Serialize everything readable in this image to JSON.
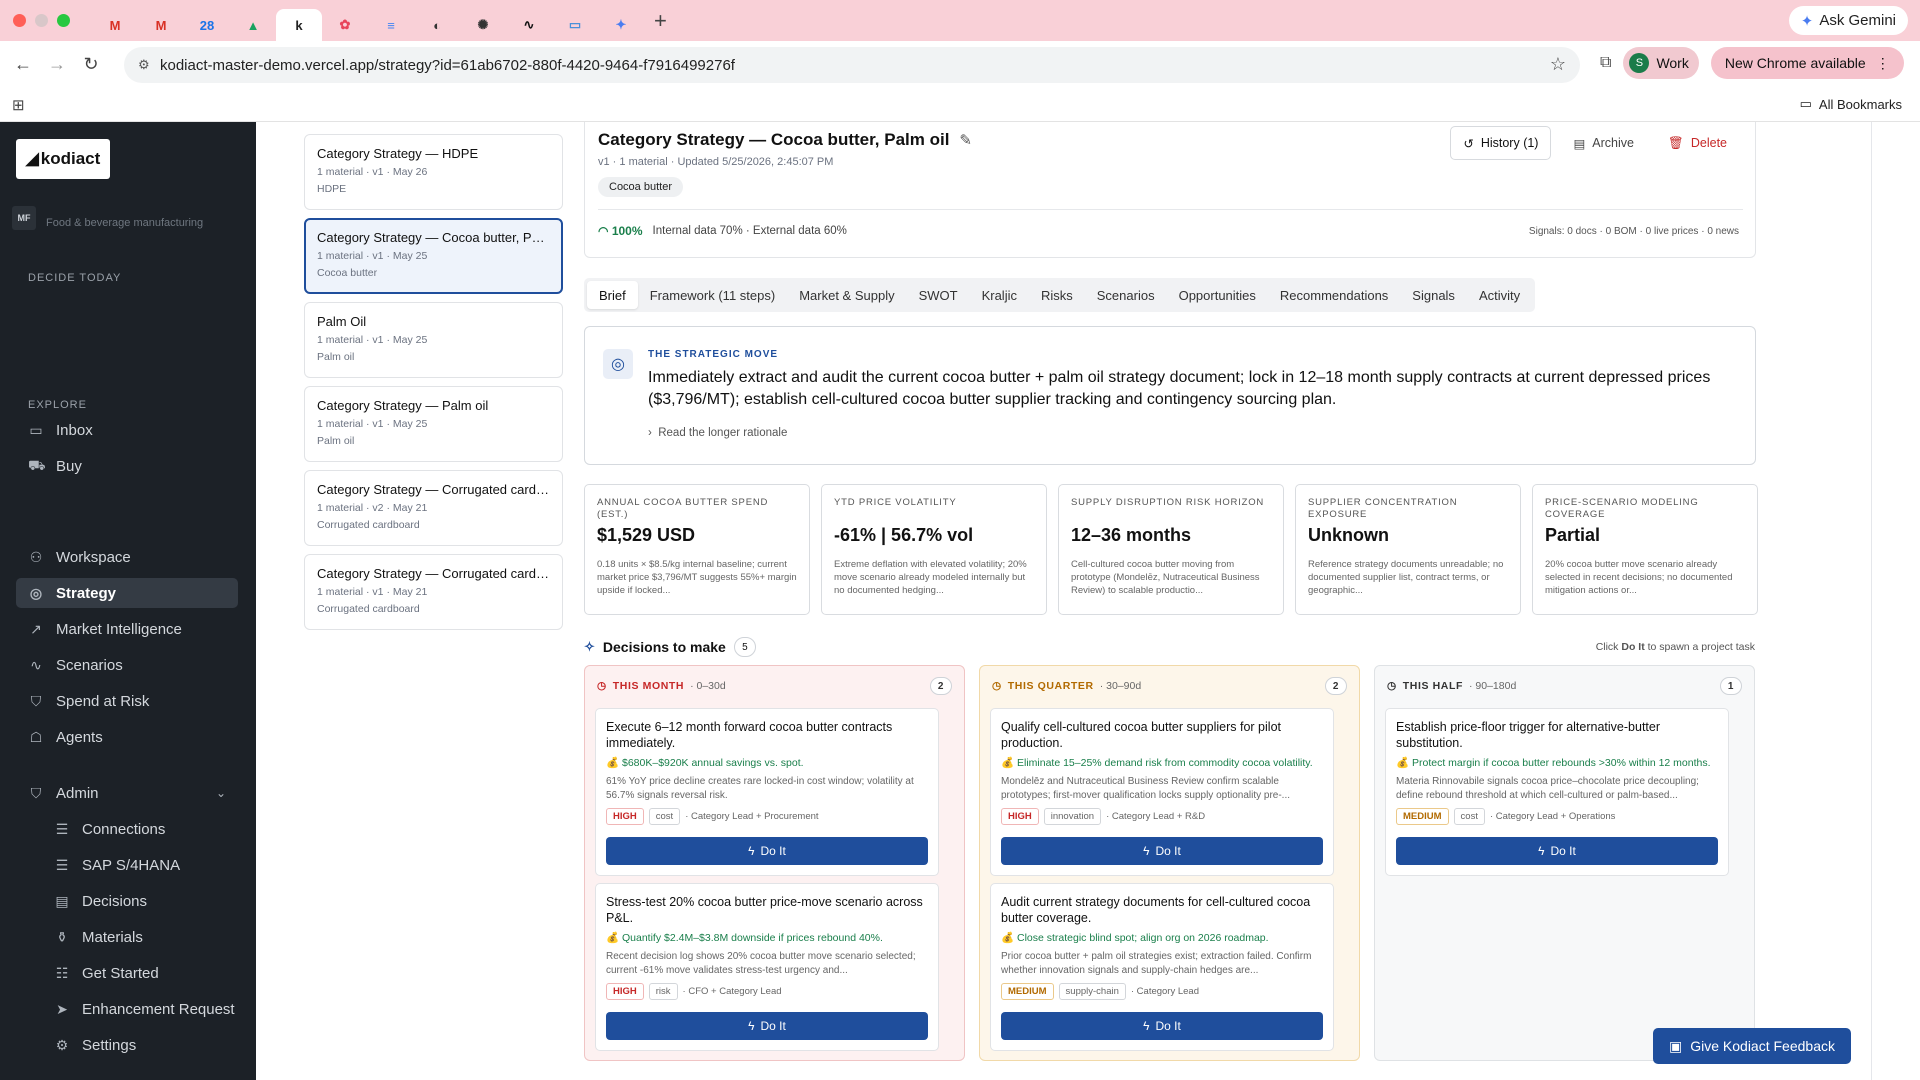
{
  "browser": {
    "tabs": [
      {
        "icon": "gmail-icon",
        "glyph": "M",
        "color": "#d93025"
      },
      {
        "icon": "gmail-icon",
        "glyph": "M",
        "color": "#d93025"
      },
      {
        "icon": "calendar-icon",
        "glyph": "28",
        "color": "#1a73e8"
      },
      {
        "icon": "drive-icon",
        "glyph": "▲",
        "color": "#1aa260"
      },
      {
        "icon": "kodiact-tab-icon",
        "glyph": "k",
        "color": "#222"
      },
      {
        "icon": "flower-icon",
        "glyph": "✿",
        "color": "#e8455a"
      },
      {
        "icon": "docs-icon",
        "glyph": "≡",
        "color": "#4285f4"
      },
      {
        "icon": "globe-icon",
        "glyph": "◐",
        "color": "#333"
      },
      {
        "icon": "openai-icon",
        "glyph": "✺",
        "color": "#333"
      },
      {
        "icon": "activity-icon",
        "glyph": "∿",
        "color": "#111"
      },
      {
        "icon": "window-icon",
        "glyph": "▭",
        "color": "#4a90d9"
      },
      {
        "icon": "gemini-tab-icon",
        "glyph": "✦",
        "color": "#4a7cf0"
      }
    ],
    "ask_gemini": "Ask Gemini",
    "url": "kodiact-master-demo.vercel.app/strategy?id=61ab6702-880f-4420-9464-f7916499276f",
    "profile_initial": "S",
    "profile_label": "Work",
    "update_label": "New Chrome available",
    "bookmarks_label": "All Bookmarks"
  },
  "sidebar": {
    "logo": "kodiact",
    "org_badge": "MF",
    "org_name": "Food & beverage manufacturing",
    "decide_label": "DECIDE TODAY",
    "explore_label": "EXPLORE",
    "items": [
      {
        "name": "inbox",
        "label": "Inbox",
        "icon": "inbox-icon",
        "glyph": "▭"
      },
      {
        "name": "buy",
        "label": "Buy",
        "icon": "cart-icon",
        "glyph": "⛟"
      },
      {
        "name": "workspace",
        "label": "Workspace",
        "icon": "users-icon",
        "glyph": "⚇"
      },
      {
        "name": "strategy",
        "label": "Strategy",
        "icon": "compass-icon",
        "glyph": "◎"
      },
      {
        "name": "market-intelligence",
        "label": "Market Intelligence",
        "icon": "trend-icon",
        "glyph": "↗"
      },
      {
        "name": "scenarios",
        "label": "Scenarios",
        "icon": "chart-line-icon",
        "glyph": "∿"
      },
      {
        "name": "spend-at-risk",
        "label": "Spend at Risk",
        "icon": "shield-icon",
        "glyph": "⛉"
      },
      {
        "name": "agents",
        "label": "Agents",
        "icon": "agent-icon",
        "glyph": "☖"
      },
      {
        "name": "admin",
        "label": "Admin",
        "icon": "shield-check-icon",
        "glyph": "⛉"
      },
      {
        "name": "connections",
        "label": "Connections",
        "icon": "database-icon",
        "glyph": "☰"
      },
      {
        "name": "sap",
        "label": "SAP S/4HANA",
        "icon": "database-icon",
        "glyph": "☰"
      },
      {
        "name": "decisions",
        "label": "Decisions",
        "icon": "clipboard-icon",
        "glyph": "▤"
      },
      {
        "name": "materials",
        "label": "Materials",
        "icon": "package-icon",
        "glyph": "⚱"
      },
      {
        "name": "get-started",
        "label": "Get Started",
        "icon": "list-check-icon",
        "glyph": "☷"
      },
      {
        "name": "enhancement-request",
        "label": "Enhancement Request",
        "icon": "send-icon",
        "glyph": "➤"
      },
      {
        "name": "settings",
        "label": "Settings",
        "icon": "gear-icon",
        "glyph": "⚙"
      }
    ]
  },
  "strategy_list": [
    {
      "title": "Category Strategy — HDPE",
      "meta": "1 material · v1 · May 26",
      "category": "HDPE"
    },
    {
      "title": "Category Strategy — Cocoa butter, Palm oil",
      "meta": "1 material · v1 · May 25",
      "category": "Cocoa butter"
    },
    {
      "title": "Palm Oil",
      "meta": "1 material · v1 · May 25",
      "category": "Palm oil"
    },
    {
      "title": "Category Strategy — Palm oil",
      "meta": "1 material · v1 · May 25",
      "category": "Palm oil"
    },
    {
      "title": "Category Strategy — Corrugated cardboard",
      "meta": "1 material · v2 · May 21",
      "category": "Corrugated cardboard"
    },
    {
      "title": "Category Strategy — Corrugated cardboard",
      "meta": "1 material · v1 · May 21",
      "category": "Corrugated cardboard"
    }
  ],
  "header": {
    "title": "Category Strategy — Cocoa butter, Palm oil",
    "meta": "v1 · 1 material · Updated 5/25/2026, 2:45:07 PM",
    "chip": "Cocoa butter",
    "history": "History (1)",
    "archive": "Archive",
    "delete": "Delete",
    "completeness": "100%",
    "data_mix": "Internal data 70% · External data 60%",
    "signals": "Signals: 0 docs · 0 BOM · 0 live prices · 0 news"
  },
  "tabs": [
    "Brief",
    "Framework (11 steps)",
    "Market & Supply",
    "SWOT",
    "Kraljic",
    "Risks",
    "Scenarios",
    "Opportunities",
    "Recommendations",
    "Signals",
    "Activity"
  ],
  "strategic_move": {
    "label": "THE STRATEGIC MOVE",
    "text": "Immediately extract and audit the current cocoa butter + palm oil strategy document; lock in 12–18 month supply contracts at current depressed prices ($3,796/MT); establish cell-cultured cocoa butter supplier tracking and contingency sourcing plan.",
    "more": "Read the longer rationale"
  },
  "kpis": [
    {
      "label": "ANNUAL COCOA BUTTER SPEND (EST.)",
      "value": "$1,529 USD",
      "desc": "0.18 units × $8.5/kg internal baseline; current market price $3,796/MT suggests 55%+ margin upside if locked..."
    },
    {
      "label": "YTD PRICE VOLATILITY",
      "value": "-61% | 56.7% vol",
      "desc": "Extreme deflation with elevated volatility; 20% move scenario already modeled internally but no documented hedging..."
    },
    {
      "label": "SUPPLY DISRUPTION RISK HORIZON",
      "value": "12–36 months",
      "desc": "Cell-cultured cocoa butter moving from prototype (Mondelēz, Nutraceutical Business Review) to scalable productio..."
    },
    {
      "label": "SUPPLIER CONCENTRATION EXPOSURE",
      "value": "Unknown",
      "desc": "Reference strategy documents unreadable; no documented supplier list, contract terms, or geographic..."
    },
    {
      "label": "PRICE-SCENARIO MODELING COVERAGE",
      "value": "Partial",
      "desc": "20% cocoa butter move scenario already selected in recent decisions; no documented mitigation actions or..."
    }
  ],
  "decisions": {
    "title": "Decisions to make",
    "count": "5",
    "hint_pre": "Click ",
    "hint_bold": "Do It",
    "hint_post": " to spawn a project task",
    "do_it": "Do It",
    "columns": [
      {
        "label": "THIS MONTH",
        "range": "· 0–30d",
        "count": "2",
        "color": "#c62828",
        "items": [
          {
            "title": "Execute 6–12 month forward cocoa butter contracts immediately.",
            "benefit": "💰 $680K–$920K annual savings vs. spot.",
            "desc": "61% YoY price decline creates rare locked-in cost window; volatility at 56.7% signals reversal risk.",
            "priority": "HIGH",
            "type": "cost",
            "owner": "· Category Lead + Procurement"
          },
          {
            "title": "Stress-test 20% cocoa butter price-move scenario across P&L.",
            "benefit": "💰 Quantify $2.4M–$3.8M downside if prices rebound 40%.",
            "desc": "Recent decision log shows 20% cocoa butter move scenario selected; current -61% move validates stress-test urgency and...",
            "priority": "HIGH",
            "type": "risk",
            "owner": "· CFO + Category Lead"
          }
        ]
      },
      {
        "label": "THIS QUARTER",
        "range": "· 30–90d",
        "count": "2",
        "color": "#b26a00",
        "items": [
          {
            "title": "Qualify cell-cultured cocoa butter suppliers for pilot production.",
            "benefit": "💰 Eliminate 15–25% demand risk from commodity cocoa volatility.",
            "desc": "Mondelēz and Nutraceutical Business Review confirm scalable prototypes; first-mover qualification locks supply optionality pre-...",
            "priority": "HIGH",
            "type": "innovation",
            "owner": "· Category Lead + R&D"
          },
          {
            "title": "Audit current strategy documents for cell-cultured cocoa butter coverage.",
            "benefit": "💰 Close strategic blind spot; align org on 2026 roadmap.",
            "desc": "Prior cocoa butter + palm oil strategies exist; extraction failed. Confirm whether innovation signals and supply-chain hedges are...",
            "priority": "MEDIUM",
            "type": "supply-chain",
            "owner": "· Category Lead"
          }
        ]
      },
      {
        "label": "THIS HALF",
        "range": "· 90–180d",
        "count": "1",
        "color": "#333333",
        "items": [
          {
            "title": "Establish price-floor trigger for alternative-butter substitution.",
            "benefit": "💰 Protect margin if cocoa butter rebounds >30% within 12 months.",
            "desc": "Materia Rinnovabile signals cocoa price–chocolate price decoupling; define rebound threshold at which cell-cultured or palm-based...",
            "priority": "MEDIUM",
            "type": "cost",
            "owner": "· Category Lead + Operations"
          }
        ]
      }
    ]
  },
  "feedback": "Give Kodiact Feedback"
}
